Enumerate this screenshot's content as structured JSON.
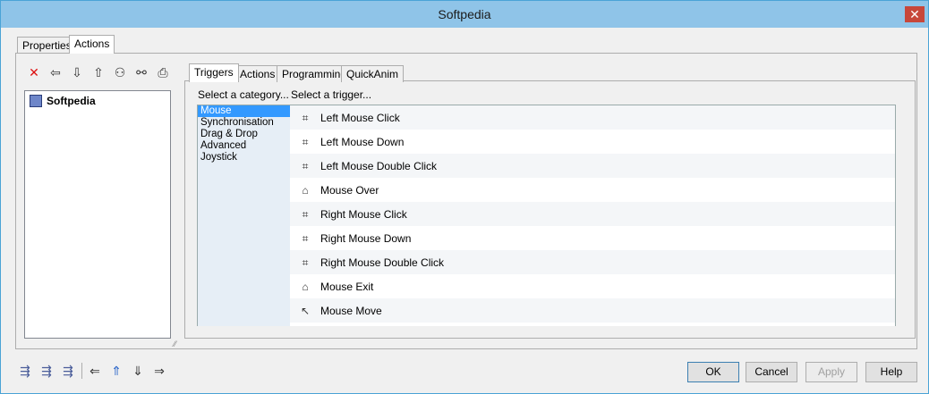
{
  "window": {
    "title": "Softpedia",
    "close_glyph": "✕"
  },
  "outer_tabs": [
    {
      "label": "Properties"
    },
    {
      "label": "Actions"
    }
  ],
  "left_toolbar": [
    {
      "icon": "delete-icon",
      "glyph": "✕"
    },
    {
      "icon": "arrow-left-icon",
      "glyph": "⇦"
    },
    {
      "icon": "arrow-down-icon",
      "glyph": "⇩"
    },
    {
      "icon": "arrow-up-icon",
      "glyph": "⇧"
    },
    {
      "icon": "group-icon",
      "glyph": "⚇"
    },
    {
      "icon": "link-icon",
      "glyph": "⚯"
    },
    {
      "icon": "print-icon",
      "glyph": "⎙"
    }
  ],
  "tree": {
    "root_label": "Softpedia"
  },
  "inner_tabs": [
    {
      "label": "Triggers"
    },
    {
      "label": "Actions"
    },
    {
      "label": "Programming"
    },
    {
      "label": "QuickAnim"
    }
  ],
  "category_header": "Select a category...",
  "trigger_header": "Select a trigger...",
  "categories": [
    "Mouse",
    "Synchronisation",
    "Drag & Drop",
    "Advanced",
    "Joystick"
  ],
  "selected_category": "Mouse",
  "triggers": [
    {
      "label": "Left Mouse Click",
      "icon": "mouse-click-icon"
    },
    {
      "label": "Left Mouse Down",
      "icon": "mouse-down-icon"
    },
    {
      "label": "Left Mouse Double Click",
      "icon": "mouse-double-click-icon"
    },
    {
      "label": "Mouse Over",
      "icon": "mouse-over-icon"
    },
    {
      "label": "Right Mouse Click",
      "icon": "mouse-click-icon"
    },
    {
      "label": "Right Mouse Down",
      "icon": "mouse-down-icon"
    },
    {
      "label": "Right Mouse Double Click",
      "icon": "mouse-double-click-icon"
    },
    {
      "label": "Mouse Exit",
      "icon": "mouse-exit-icon"
    },
    {
      "label": "Mouse Move",
      "icon": "mouse-move-icon"
    }
  ],
  "bottom_toolbar": [
    {
      "icon": "import-action-icon",
      "glyph": "⇶"
    },
    {
      "icon": "export-action-icon",
      "glyph": "⇶"
    },
    {
      "icon": "edit-action-icon",
      "glyph": "⇶"
    },
    {
      "icon": "move-left-icon",
      "glyph": "⇐"
    },
    {
      "icon": "move-up-icon",
      "glyph": "⇑"
    },
    {
      "icon": "move-down-icon",
      "glyph": "⇓"
    },
    {
      "icon": "move-right-icon",
      "glyph": "⇒"
    }
  ],
  "buttons": {
    "ok": "OK",
    "cancel": "Cancel",
    "apply": "Apply",
    "help": "Help"
  },
  "colors": {
    "titlebar": "#8fc4e8",
    "selection": "#3399ff",
    "close": "#c7473a"
  }
}
